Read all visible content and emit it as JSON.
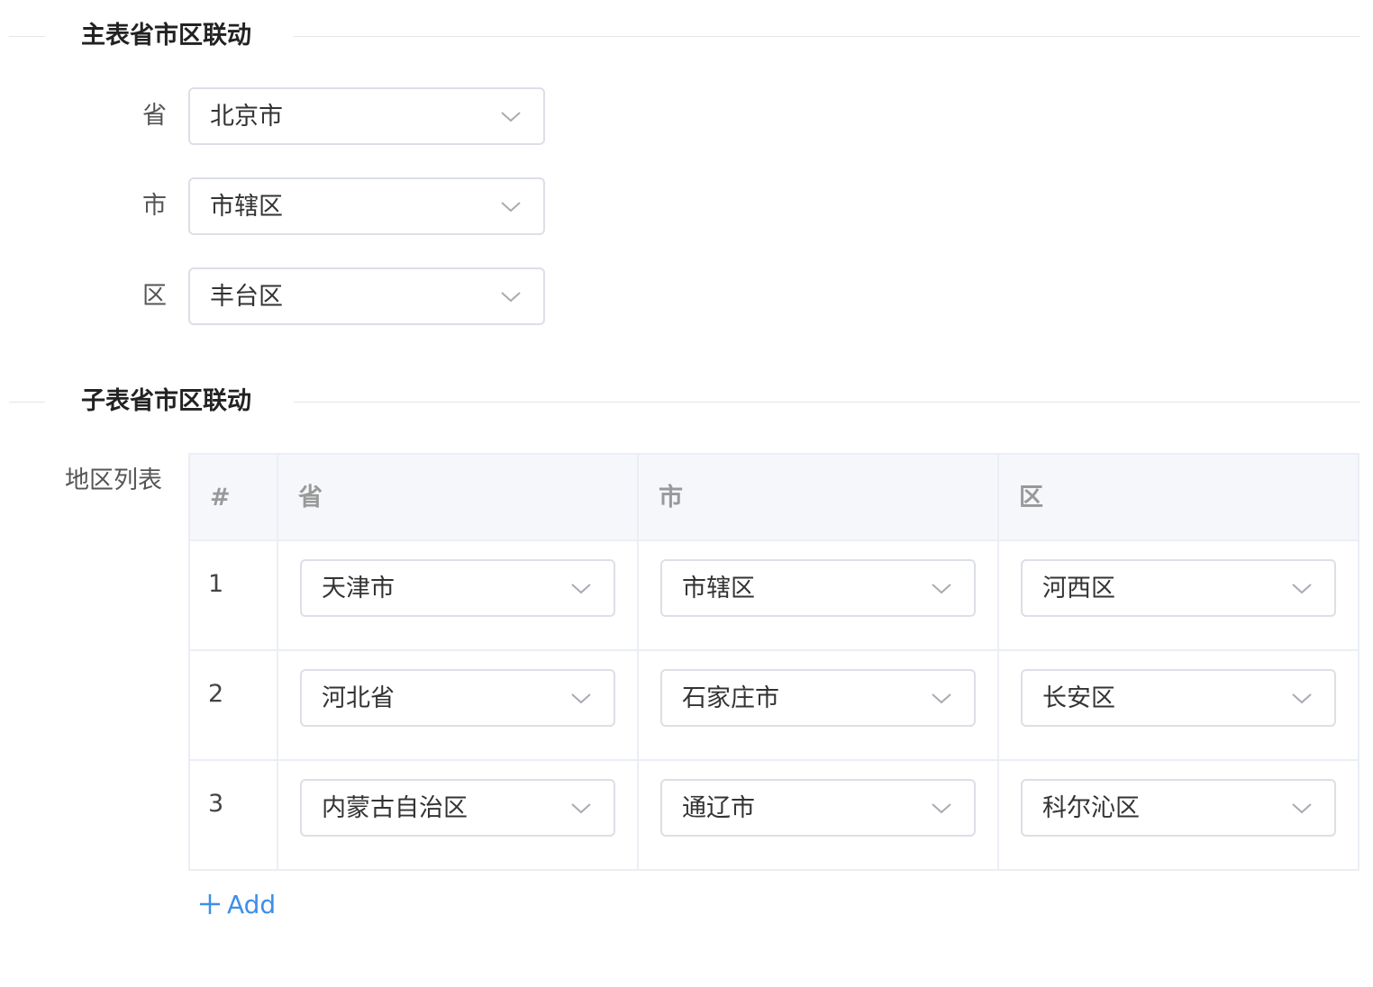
{
  "main_section": {
    "title": "主表省市区联动",
    "fields": [
      {
        "label": "省",
        "value": "北京市"
      },
      {
        "label": "市",
        "value": "市辖区"
      },
      {
        "label": "区",
        "value": "丰台区"
      }
    ]
  },
  "sub_section": {
    "title": "子表省市区联动",
    "list_label": "地区列表",
    "columns": [
      "#",
      "省",
      "市",
      "区"
    ],
    "rows": [
      {
        "index": "1",
        "province": "天津市",
        "city": "市辖区",
        "district": "河西区"
      },
      {
        "index": "2",
        "province": "河北省",
        "city": "石家庄市",
        "district": "长安区"
      },
      {
        "index": "3",
        "province": "内蒙古自治区",
        "city": "通辽市",
        "district": "科尔沁区"
      }
    ],
    "add_label": "Add"
  },
  "colors": {
    "accent": "#3d8fe8",
    "border": "#dcdfe6",
    "header_bg": "#f5f7fa"
  },
  "icons": {
    "select_arrow": "chevron-down-icon",
    "add": "plus-icon"
  }
}
